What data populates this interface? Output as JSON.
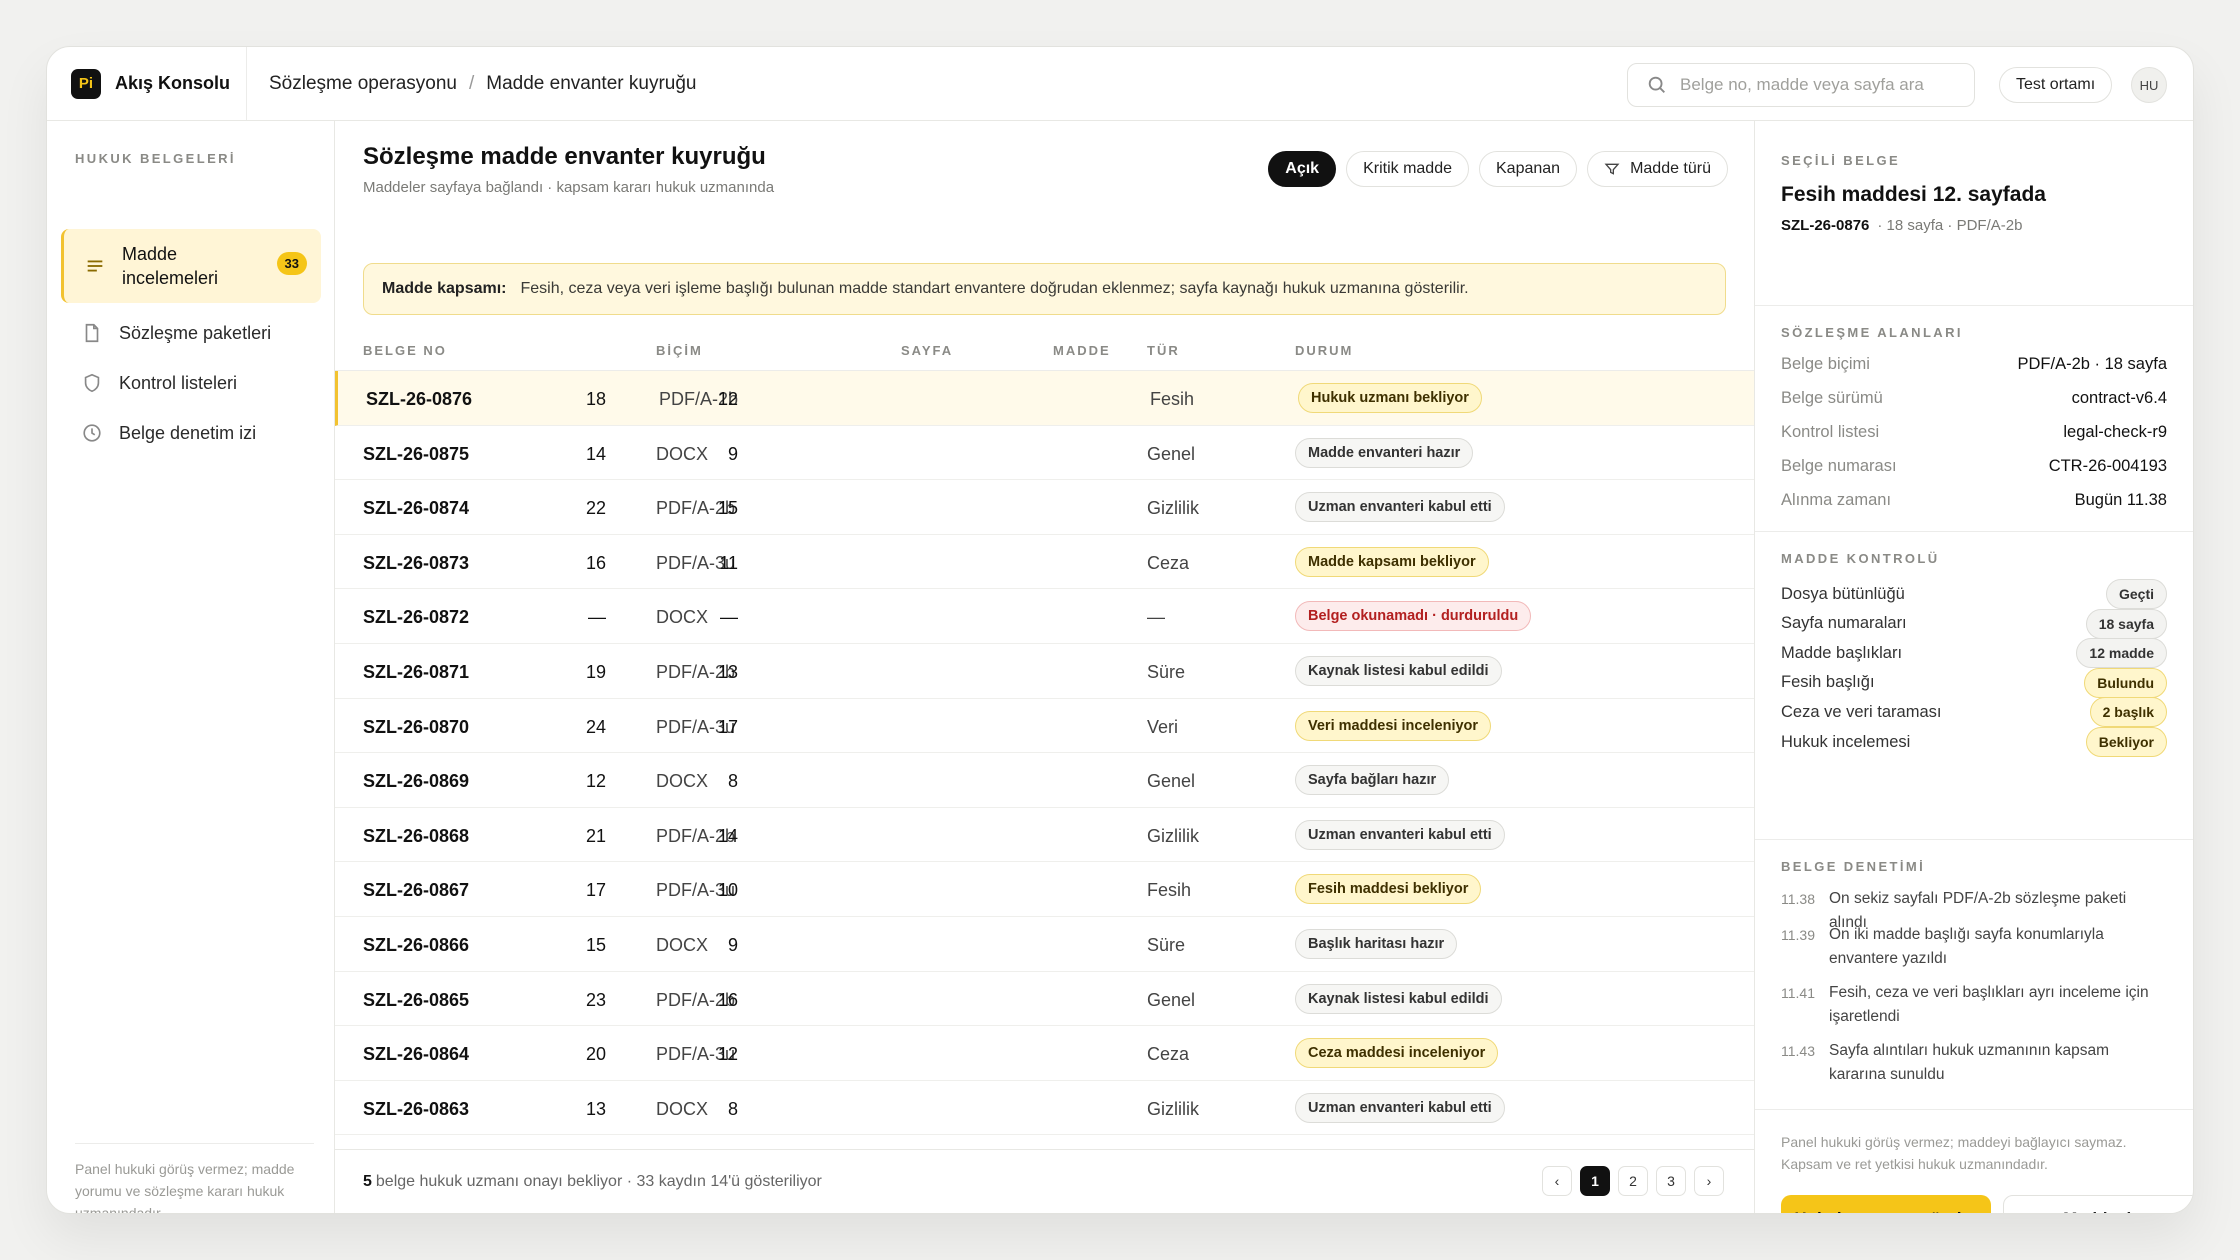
{
  "app": {
    "logo_text": "Pi",
    "name": "Akış Konsolu"
  },
  "breadcrumb": [
    "Sözleşme operasyonu",
    "Madde envanter kuyruğu"
  ],
  "breadcrumb_sep": "/",
  "search": {
    "placeholder": "Belge no, madde veya sayfa ara"
  },
  "env_label": "Test ortamı",
  "avatar_initials": "HU",
  "sidebar": {
    "heading": "HUKUK BELGELERİ",
    "items": [
      {
        "label": "Madde incelemeleri",
        "badge": "33",
        "icon": "list-icon"
      },
      {
        "label": "Sözleşme paketleri",
        "icon": "document-icon"
      },
      {
        "label": "Kontrol listeleri",
        "icon": "shield-icon"
      },
      {
        "label": "Belge denetim izi",
        "icon": "clock-icon"
      }
    ],
    "footer": "Panel hukuki görüş vermez; madde yorumu ve sözleşme kararı hukuk uzmanındadır."
  },
  "main": {
    "title": "Sözleşme madde envanter kuyruğu",
    "subtitle": "Maddeler sayfaya bağlandı · kapsam kararı hukuk uzmanında",
    "filters": [
      "Açık",
      "Kritik madde",
      "Kapanan",
      "Madde türü"
    ],
    "notice_label": "Madde kapsamı:",
    "notice_text": "Fesih, ceza veya veri işleme başlığı bulunan madde standart envantere doğrudan eklenmez; sayfa kaynağı hukuk uzmanına gösterilir.",
    "columns": [
      "BELGE NO",
      "BİÇİM",
      "SAYFA",
      "MADDE",
      "TÜR",
      "DURUM"
    ],
    "rows": [
      {
        "no": "SZL-26-0876",
        "format": "PDF/A-2b",
        "pages": "18",
        "articles": "12",
        "type": "Fesih",
        "status": "Hukuk uzmanı bekliyor",
        "tone": "y"
      },
      {
        "no": "SZL-26-0875",
        "format": "DOCX",
        "pages": "14",
        "articles": "9",
        "type": "Genel",
        "status": "Madde envanteri hazır",
        "tone": "n"
      },
      {
        "no": "SZL-26-0874",
        "format": "PDF/A-2b",
        "pages": "22",
        "articles": "15",
        "type": "Gizlilik",
        "status": "Uzman envanteri kabul etti",
        "tone": "n"
      },
      {
        "no": "SZL-26-0873",
        "format": "PDF/A-3u",
        "pages": "16",
        "articles": "11",
        "type": "Ceza",
        "status": "Madde kapsamı bekliyor",
        "tone": "y"
      },
      {
        "no": "SZL-26-0872",
        "format": "DOCX",
        "pages": "—",
        "articles": "—",
        "type": "—",
        "status": "Belge okunamadı · durduruldu",
        "tone": "r"
      },
      {
        "no": "SZL-26-0871",
        "format": "PDF/A-2b",
        "pages": "19",
        "articles": "13",
        "type": "Süre",
        "status": "Kaynak listesi kabul edildi",
        "tone": "n"
      },
      {
        "no": "SZL-26-0870",
        "format": "PDF/A-3u",
        "pages": "24",
        "articles": "17",
        "type": "Veri",
        "status": "Veri maddesi inceleniyor",
        "tone": "y"
      },
      {
        "no": "SZL-26-0869",
        "format": "DOCX",
        "pages": "12",
        "articles": "8",
        "type": "Genel",
        "status": "Sayfa bağları hazır",
        "tone": "n"
      },
      {
        "no": "SZL-26-0868",
        "format": "PDF/A-2b",
        "pages": "21",
        "articles": "14",
        "type": "Gizlilik",
        "status": "Uzman envanteri kabul etti",
        "tone": "n"
      },
      {
        "no": "SZL-26-0867",
        "format": "PDF/A-3u",
        "pages": "17",
        "articles": "10",
        "type": "Fesih",
        "status": "Fesih maddesi bekliyor",
        "tone": "y"
      },
      {
        "no": "SZL-26-0866",
        "format": "DOCX",
        "pages": "15",
        "articles": "9",
        "type": "Süre",
        "status": "Başlık haritası hazır",
        "tone": "n"
      },
      {
        "no": "SZL-26-0865",
        "format": "PDF/A-2b",
        "pages": "23",
        "articles": "16",
        "type": "Genel",
        "status": "Kaynak listesi kabul edildi",
        "tone": "n"
      },
      {
        "no": "SZL-26-0864",
        "format": "PDF/A-3u",
        "pages": "20",
        "articles": "12",
        "type": "Ceza",
        "status": "Ceza maddesi inceleniyor",
        "tone": "y"
      },
      {
        "no": "SZL-26-0863",
        "format": "DOCX",
        "pages": "13",
        "articles": "8",
        "type": "Gizlilik",
        "status": "Uzman envanteri kabul etti",
        "tone": "n"
      }
    ],
    "footer_count": "5",
    "footer_text": "belge hukuk uzmanı onayı bekliyor · 33 kaydın 14'ü gösteriliyor",
    "pages": [
      "‹",
      "1",
      "2",
      "3",
      "›"
    ]
  },
  "panel": {
    "selected_heading": "SEÇİLİ BELGE",
    "title": "Fesih maddesi 12. sayfada",
    "doc_no": "SZL-26-0876",
    "doc_meta": "· 18 sayfa · PDF/A-2b",
    "fields_heading": "SÖZLEŞME ALANLARI",
    "fields": [
      {
        "k": "Belge biçimi",
        "v": "PDF/A-2b · 18 sayfa"
      },
      {
        "k": "Belge sürümü",
        "v": "contract-v6.4"
      },
      {
        "k": "Kontrol listesi",
        "v": "legal-check-r9"
      },
      {
        "k": "Belge numarası",
        "v": "CTR-26-004193"
      },
      {
        "k": "Alınma zamanı",
        "v": "Bugün 11.38"
      }
    ],
    "checks_heading": "MADDE KONTROLÜ",
    "checks": [
      {
        "k": "Dosya bütünlüğü",
        "v": "Geçti",
        "tone": "n"
      },
      {
        "k": "Sayfa numaraları",
        "v": "18 sayfa",
        "tone": "n"
      },
      {
        "k": "Madde başlıkları",
        "v": "12 madde",
        "tone": "n"
      },
      {
        "k": "Fesih başlığı",
        "v": "Bulundu",
        "tone": "y"
      },
      {
        "k": "Ceza ve veri taraması",
        "v": "2 başlık",
        "tone": "y"
      },
      {
        "k": "Hukuk incelemesi",
        "v": "Bekliyor",
        "tone": "y"
      }
    ],
    "audit_heading": "BELGE DENETİMİ",
    "audit": [
      {
        "t": "11.38",
        "text": "On sekiz sayfalı PDF/A-2b sözleşme paketi alındı"
      },
      {
        "t": "11.39",
        "text": "On iki madde başlığı sayfa konumlarıyla envantere yazıldı"
      },
      {
        "t": "11.41",
        "text": "Fesih, ceza ve veri başlıkları ayrı inceleme için işaretlendi"
      },
      {
        "t": "11.43",
        "text": "Sayfa alıntıları hukuk uzmanının kapsam kararına sunuldu"
      }
    ],
    "note": "Panel hukuki görüş vermez; maddeyi bağlayıcı saymaz. Kapsam ve ret yetkisi hukuk uzmanındadır.",
    "primary_button": "Hukuk onayına gönder",
    "secondary_button": "Maddeyi aç"
  },
  "colors": {
    "accent": "#f5c518",
    "dark": "#111111",
    "danger": "#b32020"
  }
}
